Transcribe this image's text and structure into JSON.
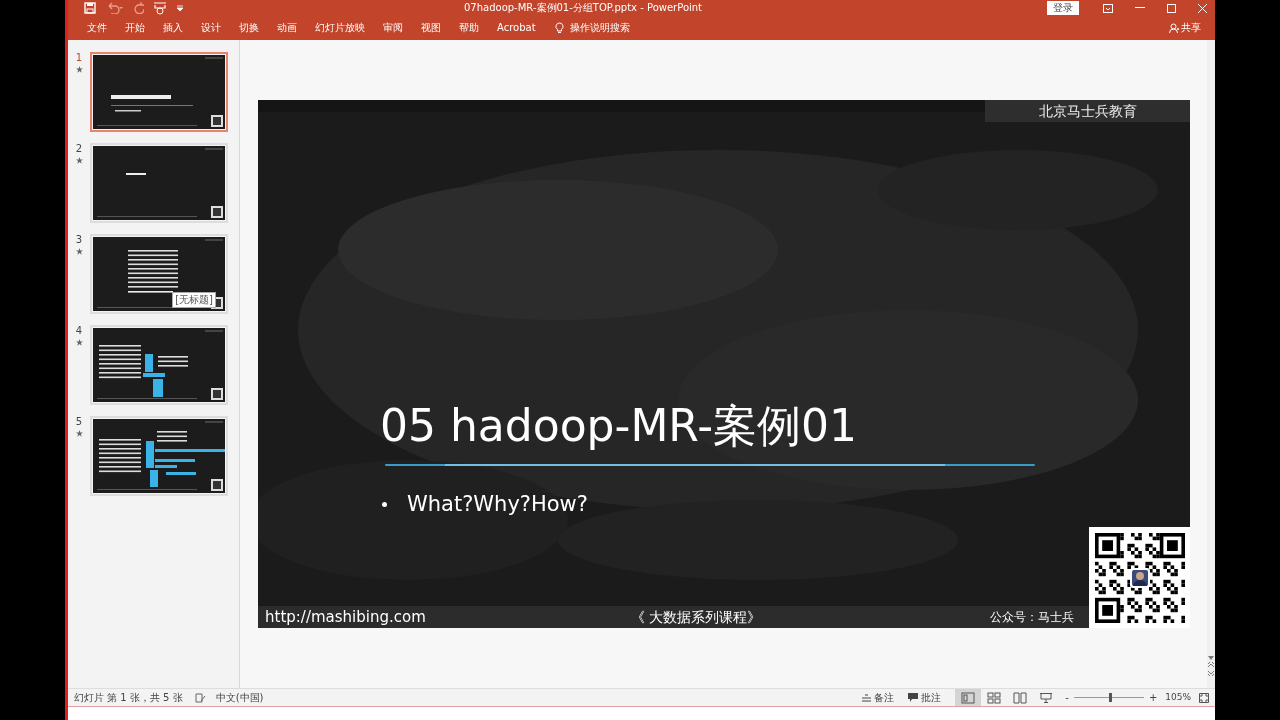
{
  "window": {
    "title": "07hadoop-MR-案例01-分组TOP.pptx  -  PowerPoint",
    "login": "登录"
  },
  "ribbon": {
    "tabs": [
      {
        "label": "文件",
        "selected": false
      },
      {
        "label": "开始",
        "selected": false
      },
      {
        "label": "插入",
        "selected": false
      },
      {
        "label": "设计",
        "selected": false
      },
      {
        "label": "切换",
        "selected": false
      },
      {
        "label": "动画",
        "selected": false
      },
      {
        "label": "幻灯片放映",
        "selected": false
      },
      {
        "label": "审阅",
        "selected": false
      },
      {
        "label": "视图",
        "selected": false
      },
      {
        "label": "帮助",
        "selected": false
      },
      {
        "label": "Acrobat",
        "selected": false
      }
    ],
    "search": "操作说明搜索",
    "share": "共享"
  },
  "thumbnails": [
    {
      "number": "1",
      "selected": true,
      "animated": true,
      "kind": "title"
    },
    {
      "number": "2",
      "selected": false,
      "animated": true,
      "kind": "section"
    },
    {
      "number": "3",
      "selected": false,
      "animated": true,
      "kind": "table",
      "tooltip": "[无标题]"
    },
    {
      "number": "4",
      "selected": false,
      "animated": true,
      "kind": "diagram"
    },
    {
      "number": "5",
      "selected": false,
      "animated": true,
      "kind": "diagram-wide"
    }
  ],
  "slide": {
    "header": "北京马士兵教育",
    "title": "05 hadoop-MR-案例01",
    "bullets": [
      "What?Why?How?"
    ],
    "footer_url": "http://mashibing.com",
    "footer_course": "《 大数据系列课程》",
    "footer_account": "公众号：马士兵"
  },
  "status_bar": {
    "slide_info": "幻灯片 第 1 张，共 5 张",
    "language": "中文(中国)",
    "notes": "备注",
    "comments": "批注",
    "views": [
      {
        "kind": "normal",
        "selected": true
      },
      {
        "kind": "sorter",
        "selected": false
      },
      {
        "kind": "reading",
        "selected": false
      },
      {
        "kind": "slideshow",
        "selected": false
      }
    ],
    "zoom": {
      "minus": "-",
      "plus": "+",
      "level": 0.53,
      "value": "105%"
    }
  }
}
